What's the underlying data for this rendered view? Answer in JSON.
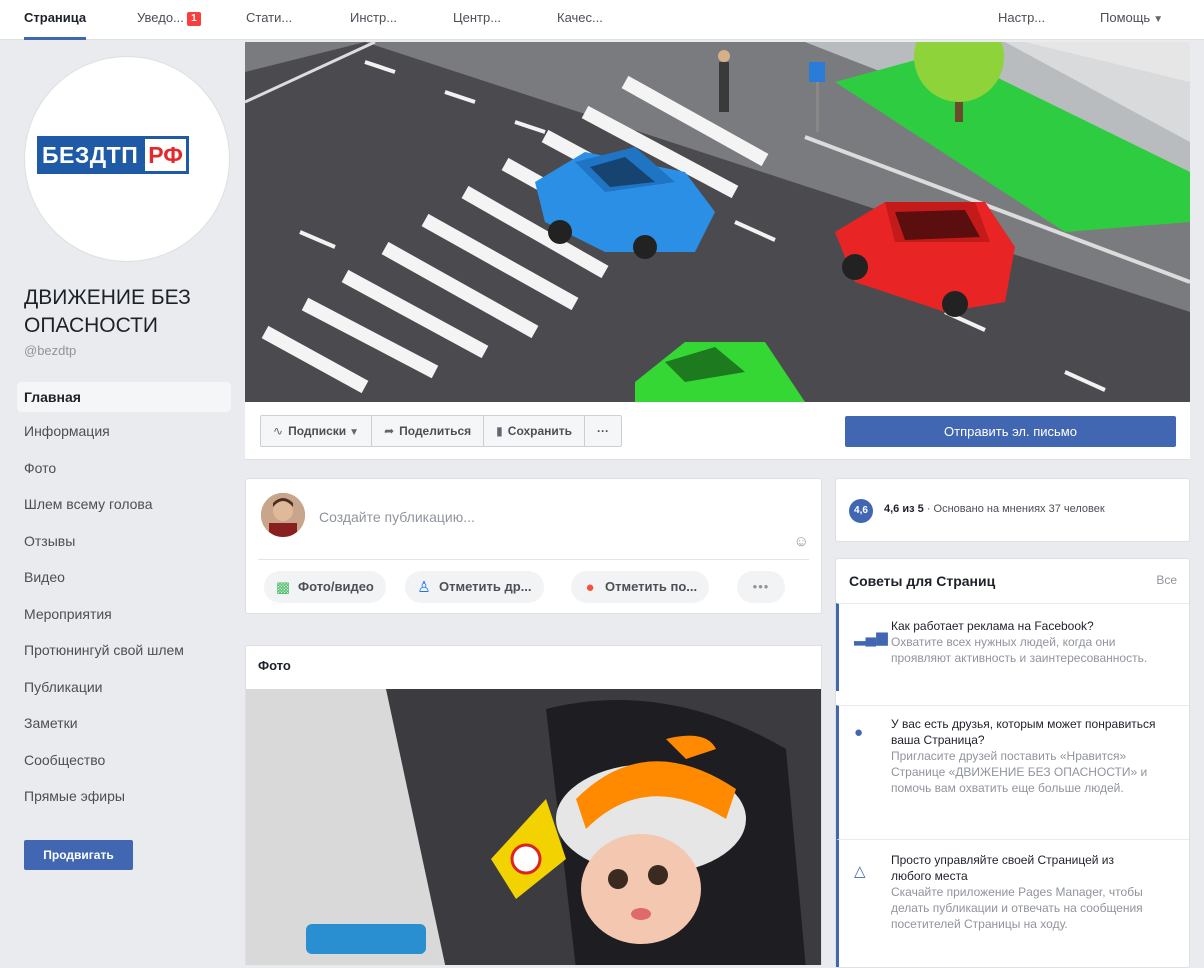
{
  "topnav": {
    "page": "Страница",
    "notifications": "Уведо...",
    "notifications_count": "1",
    "stats": "Стати...",
    "tools": "Инстр...",
    "center": "Центр...",
    "quality": "Качес...",
    "settings": "Настр...",
    "help": "Помощь"
  },
  "page": {
    "logo_left": "БЕЗДТП",
    "logo_right": "РФ",
    "name": "ДВИЖЕНИЕ БЕЗ ОПАСНОСТИ",
    "handle": "@bezdtp"
  },
  "sidenav": {
    "items": [
      "Главная",
      "Информация",
      "Фото",
      "Шлем всему голова",
      "Отзывы",
      "Видео",
      "Мероприятия",
      "Протюнингуй свой шлем",
      "Публикации",
      "Заметки",
      "Сообщество",
      "Прямые эфиры"
    ],
    "promote": "Продвигать"
  },
  "actions": {
    "subscriptions": "Подписки",
    "share": "Поделиться",
    "save": "Сохранить",
    "more": "···",
    "email": "Отправить эл. письмо"
  },
  "composer": {
    "placeholder": "Создайте публикацию...",
    "photo_video": "Фото/видео",
    "tag_friends": "Отметить др...",
    "check_in": "Отметить по...",
    "more": "•••"
  },
  "photos": {
    "header": "Фото"
  },
  "rating": {
    "score": "4,6",
    "text_bold": "4,6 из 5",
    "text_rest": " · Основано на мнениях 37 человек"
  },
  "tips": {
    "title": "Советы для Страниц",
    "all": "Все",
    "items": [
      {
        "title": "Как работает реклама на Facebook?",
        "body": "Охватите всех нужных людей, когда они проявляют активность и заинтересованность."
      },
      {
        "title": "У вас есть друзья, которым может понравиться ваша Страница?",
        "body": "Пригласите друзей поставить «Нравится» Странице «ДВИЖЕНИЕ БЕЗ ОПАСНОСТИ» и помочь вам охватить еще больше людей."
      },
      {
        "title": "Просто управляйте своей Страницей из любого места",
        "body": "Скачайте приложение Pages Manager, чтобы делать публикации и отвечать на сообщения посетителей Страницы на ходу."
      }
    ]
  },
  "colors": {
    "accent": "#4267b2",
    "badge": "#fa3e3e",
    "logo_blue": "#1f5aa6",
    "logo_red": "#e3292c"
  },
  "icons": {
    "subscriptions": "rss-icon",
    "share": "share-arrow-icon",
    "save": "bookmark-icon",
    "photo": "photo-icon",
    "tag": "tag-person-icon",
    "checkin": "location-pin-icon",
    "emoji": "smiley-icon",
    "tip1": "bar-chart-icon",
    "tip2": "lightbulb-icon",
    "tip3": "pages-manager-icon"
  }
}
